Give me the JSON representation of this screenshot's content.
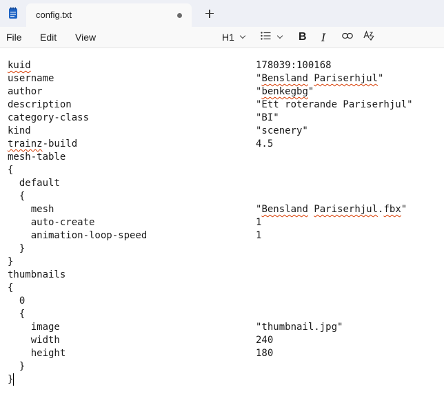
{
  "tab": {
    "title": "config.txt"
  },
  "menu": {
    "file": "File",
    "edit": "Edit",
    "view": "View"
  },
  "toolbar": {
    "heading": "H1"
  },
  "editor": {
    "lines": [
      {
        "key": "kuid",
        "value": "178039:100168"
      },
      {
        "key": "username",
        "value": "\"Bensland Pariserhjul\""
      },
      {
        "key": "author",
        "value": "\"benkegbg\""
      },
      {
        "key": "description",
        "value": "\"Ett roterande Pariserhjul\""
      },
      {
        "key": "category-class",
        "value": "\"BI\""
      },
      {
        "key": "kind",
        "value": "\"scenery\""
      },
      {
        "key": "trainz-build",
        "value": "4.5"
      },
      {
        "key": "mesh-table",
        "value": ""
      },
      {
        "key": "{",
        "value": ""
      },
      {
        "key": "  default",
        "value": ""
      },
      {
        "key": "  {",
        "value": ""
      },
      {
        "key": "    mesh",
        "value": "\"Bensland Pariserhjul.fbx\""
      },
      {
        "key": "    auto-create",
        "value": "1"
      },
      {
        "key": "    animation-loop-speed",
        "value": "1"
      },
      {
        "key": "  }",
        "value": ""
      },
      {
        "key": "}",
        "value": ""
      },
      {
        "key": "thumbnails",
        "value": ""
      },
      {
        "key": "{",
        "value": ""
      },
      {
        "key": "  0",
        "value": ""
      },
      {
        "key": "  {",
        "value": ""
      },
      {
        "key": "    image",
        "value": "\"thumbnail.jpg\""
      },
      {
        "key": "    width",
        "value": "240"
      },
      {
        "key": "    height",
        "value": "180"
      },
      {
        "key": "  }",
        "value": ""
      },
      {
        "key": "}",
        "value": ""
      }
    ],
    "spell_errors": [
      "kuid",
      "Bensland",
      "benkegbg",
      "trainz",
      "Pariserhjul"
    ]
  },
  "colors": {
    "tabbar_bg": "#eef0f6",
    "spell_underline": "#d83b01",
    "app_icon": "#1e63c4"
  },
  "icons": [
    "notepad-app-icon",
    "close-tab-dot-icon",
    "new-tab-plus-icon",
    "bullet-list-icon",
    "chevron-down-icon",
    "link-icon",
    "spellcheck-icon"
  ]
}
